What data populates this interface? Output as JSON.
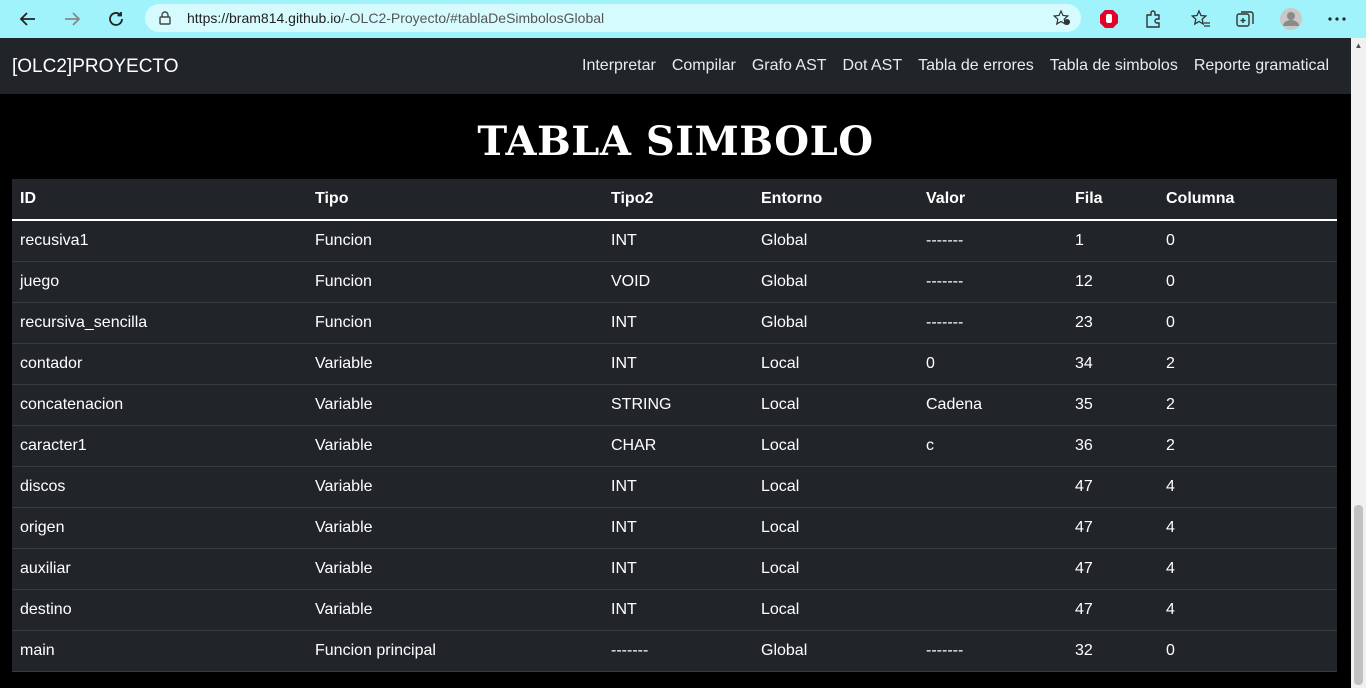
{
  "browser": {
    "url_host": "https://bram814.github.io",
    "url_path": "/-OLC2-Proyecto/#tablaDeSimbolosGlobal"
  },
  "navbar": {
    "brand": "[OLC2]PROYECTO",
    "links": [
      "Interpretar",
      "Compilar",
      "Grafo AST",
      "Dot AST",
      "Tabla de errores",
      "Tabla de simbolos",
      "Reporte gramatical"
    ]
  },
  "page": {
    "title": "TABLA SIMBOLO"
  },
  "table": {
    "headers": [
      "ID",
      "Tipo",
      "Tipo2",
      "Entorno",
      "Valor",
      "Fila",
      "Columna"
    ],
    "rows": [
      [
        "recusiva1",
        "Funcion",
        "INT",
        "Global",
        "-------",
        "1",
        "0"
      ],
      [
        "juego",
        "Funcion",
        "VOID",
        "Global",
        "-------",
        "12",
        "0"
      ],
      [
        "recursiva_sencilla",
        "Funcion",
        "INT",
        "Global",
        "-------",
        "23",
        "0"
      ],
      [
        "contador",
        "Variable",
        "INT",
        "Local",
        "0",
        "34",
        "2"
      ],
      [
        "concatenacion",
        "Variable",
        "STRING",
        "Local",
        "Cadena",
        "35",
        "2"
      ],
      [
        "caracter1",
        "Variable",
        "CHAR",
        "Local",
        "c",
        "36",
        "2"
      ],
      [
        "discos",
        "Variable",
        "INT",
        "Local",
        "",
        "47",
        "4"
      ],
      [
        "origen",
        "Variable",
        "INT",
        "Local",
        "",
        "47",
        "4"
      ],
      [
        "auxiliar",
        "Variable",
        "INT",
        "Local",
        "",
        "47",
        "4"
      ],
      [
        "destino",
        "Variable",
        "INT",
        "Local",
        "",
        "47",
        "4"
      ],
      [
        "main",
        "Funcion principal",
        "-------",
        "Global",
        "-------",
        "32",
        "0"
      ]
    ]
  },
  "colors": {
    "chrome": "#a0f3fb",
    "navbar": "#212529",
    "table_bg": "#212529",
    "page_bg": "#000000"
  }
}
